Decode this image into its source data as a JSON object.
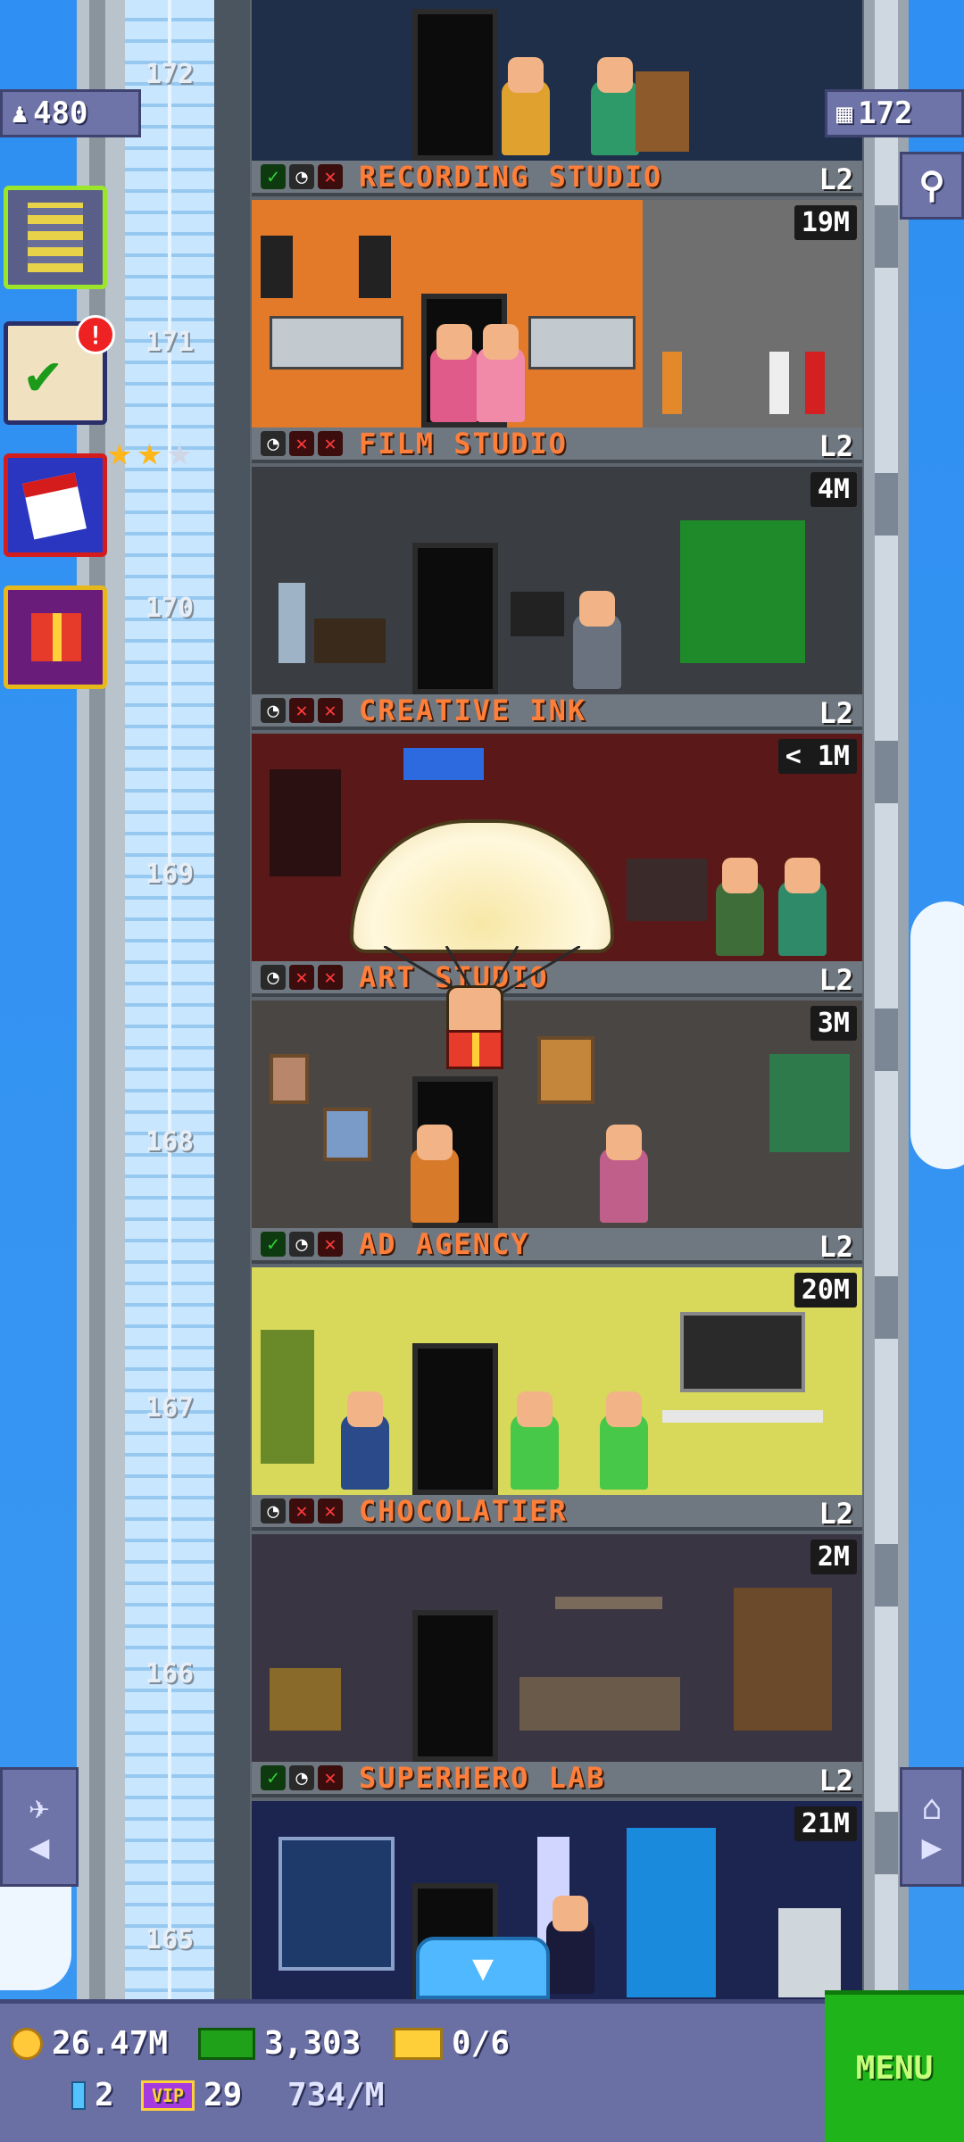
{
  "top": {
    "population": "480",
    "floors": "172"
  },
  "elevator": {
    "floor_numbers": [
      "172",
      "171",
      "170",
      "169",
      "168",
      "167",
      "166",
      "165"
    ]
  },
  "side": {
    "notification_badge": "!"
  },
  "floors": [
    {
      "name": "RECORDING STUDIO",
      "level": "L2",
      "value": "19M",
      "status": [
        "check",
        "clock",
        "x"
      ]
    },
    {
      "name": "FILM STUDIO",
      "level": "L2",
      "value": "4M",
      "status": [
        "clock",
        "x",
        "x"
      ]
    },
    {
      "name": "CREATIVE INK",
      "level": "L2",
      "value": "< 1M",
      "status": [
        "clock",
        "x",
        "x"
      ]
    },
    {
      "name": "ART STUDIO",
      "level": "L2",
      "value": "3M",
      "status": [
        "clock",
        "x",
        "x"
      ]
    },
    {
      "name": "AD AGENCY",
      "level": "L2",
      "value": "20M",
      "status": [
        "check",
        "clock",
        "x"
      ]
    },
    {
      "name": "CHOCOLATIER",
      "level": "L2",
      "value": "2M",
      "status": [
        "clock",
        "x",
        "x"
      ]
    },
    {
      "name": "SUPERHERO LAB",
      "level": "L2",
      "value": "21M",
      "status": [
        "check",
        "clock",
        "x"
      ]
    }
  ],
  "bottom": {
    "coins": "26.47M",
    "bux": "3,303",
    "tickets": "0/6",
    "elevators": "2",
    "vip": "29",
    "rate": "734/M",
    "menu_label": "MENU"
  },
  "icons": {
    "population": "person-icon",
    "floors": "building-icon",
    "search": "magnifier-icon",
    "tower": "tower-icon",
    "missions": "checklist-icon",
    "calendar": "calendar-icon",
    "gift": "gift-icon",
    "star": "star-icon",
    "coin": "coin-icon",
    "bux": "tower-bux-icon",
    "ticket": "golden-ticket-icon",
    "elevator": "elevator-icon",
    "vip": "vip-icon"
  },
  "colors": {
    "floor_name": "#ff7f3a",
    "menu_bg": "#1fb51a",
    "bar_bg": "#6a6fa4",
    "sky": "#2f8ff2"
  }
}
